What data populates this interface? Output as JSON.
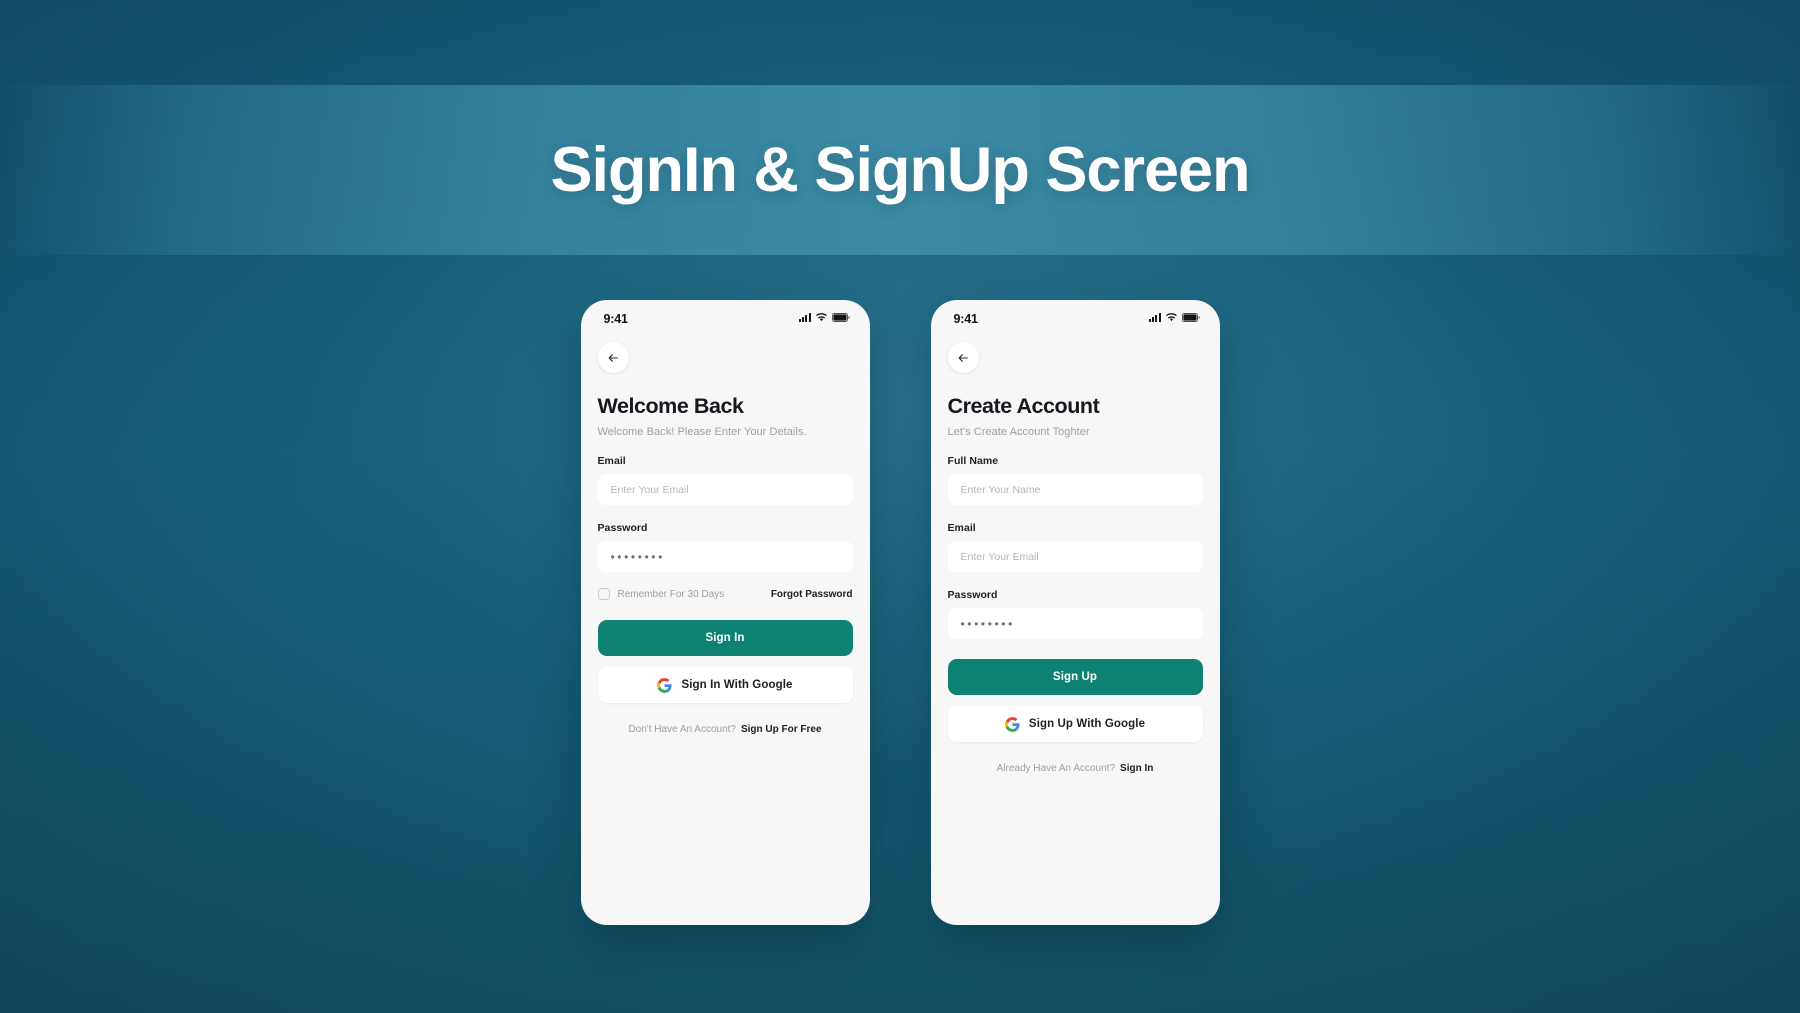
{
  "banner": {
    "title": "SignIn & SignUp Screen"
  },
  "colors": {
    "page_background": "#16607C",
    "banner_band": "#3C8AA5",
    "primary_button": "#0E8272",
    "screen_background": "#F7F7F7",
    "input_background": "#FFFFFF",
    "heading_text": "#15181D",
    "muted_text": "#9B9FA6"
  },
  "signin": {
    "status_bar": {
      "time": "9:41",
      "icons": [
        "cellular-signal-icon",
        "wifi-icon",
        "battery-icon"
      ]
    },
    "back_button": {
      "icon": "arrow-left-icon"
    },
    "heading": "Welcome Back",
    "subheading": "Welcome Back! Please Enter Your Details.",
    "fields": [
      {
        "label": "Email",
        "placeholder": "Enter Your Email",
        "value": "",
        "type": "email"
      },
      {
        "label": "Password",
        "placeholder": "",
        "value": "••••••••",
        "type": "password"
      }
    ],
    "remember_label": "Remember For 30 Days",
    "remember_checked": false,
    "forgot_label": "Forgot Password",
    "primary_button": "Sign In",
    "google_button": "Sign In With Google",
    "footer_text": "Don't Have An Account?",
    "footer_link": "Sign Up For Free"
  },
  "signup": {
    "status_bar": {
      "time": "9:41",
      "icons": [
        "cellular-signal-icon",
        "wifi-icon",
        "battery-icon"
      ]
    },
    "back_button": {
      "icon": "arrow-left-icon"
    },
    "heading": "Create Account",
    "subheading": "Let's Create Account Toghter",
    "fields": [
      {
        "label": "Full Name",
        "placeholder": "Enter Your Name",
        "value": "",
        "type": "text"
      },
      {
        "label": "Email",
        "placeholder": "Enter Your Email",
        "value": "",
        "type": "email"
      },
      {
        "label": "Password",
        "placeholder": "",
        "value": "••••••••",
        "type": "password"
      }
    ],
    "primary_button": "Sign Up",
    "google_button": "Sign Up With Google",
    "footer_text": "Already Have An Account?",
    "footer_link": "Sign In"
  }
}
